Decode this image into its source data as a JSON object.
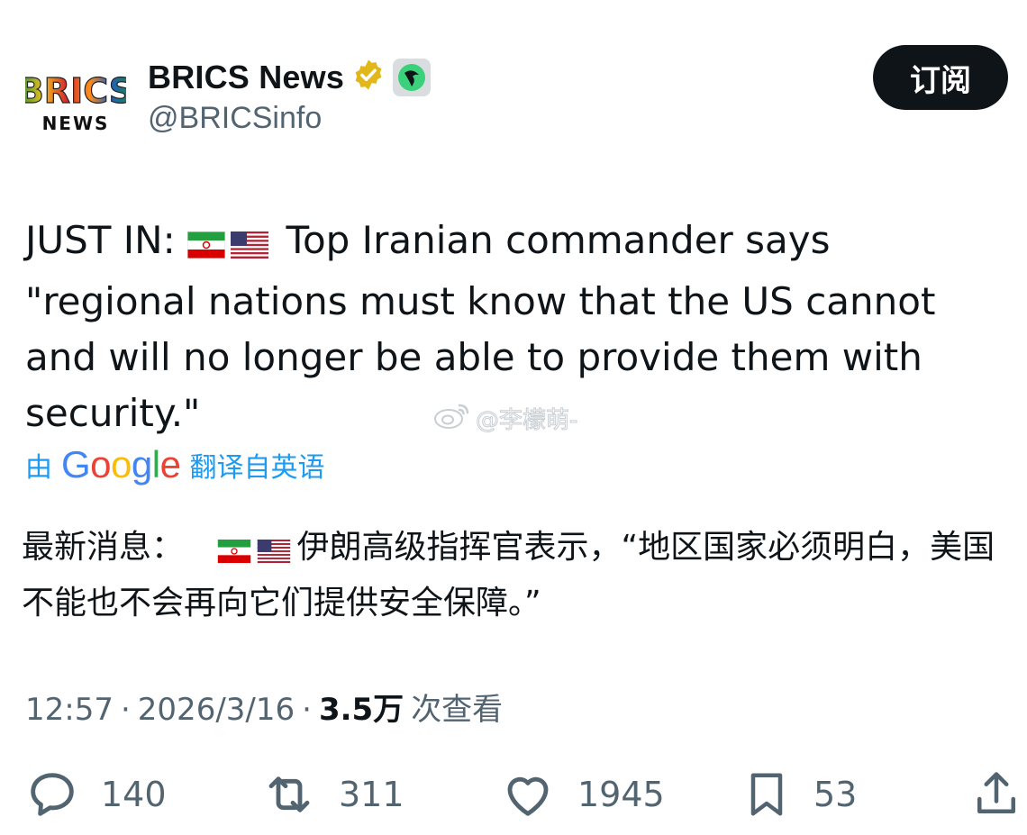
{
  "author": {
    "display_name": "BRICS News",
    "handle": "@BRICSinfo",
    "avatar_text_top": "BRICS",
    "avatar_text_bottom": "NEWS"
  },
  "subscribe_label": "订阅",
  "tweet": {
    "prefix": "JUST IN:",
    "flags": [
      "iran-flag-icon",
      "us-flag-icon"
    ],
    "text": " Top Iranian commander says \"regional nations must know that the US cannot and will no longer be able to provide them with security.\""
  },
  "watermark": "@李檬萌-",
  "translation": {
    "by": "由",
    "google": "Google",
    "from": "翻译自英语",
    "prefix": "最新消息：",
    "text": "伊朗高级指挥官表示，“地区国家必须明白，美国不能也不会再向它们提供安全保障。”"
  },
  "meta": {
    "time": "12:57",
    "sep1": "·",
    "date": "2026/3/16",
    "sep2": "·",
    "views": "3.5万",
    "views_label": "次查看"
  },
  "actions": {
    "replies": "140",
    "reposts": "311",
    "likes": "1945",
    "bookmarks": "53"
  },
  "colors": {
    "accent": "#1d9bf0",
    "text": "#0f1419",
    "muted": "#536471",
    "verified_gold": "#e2b719"
  }
}
